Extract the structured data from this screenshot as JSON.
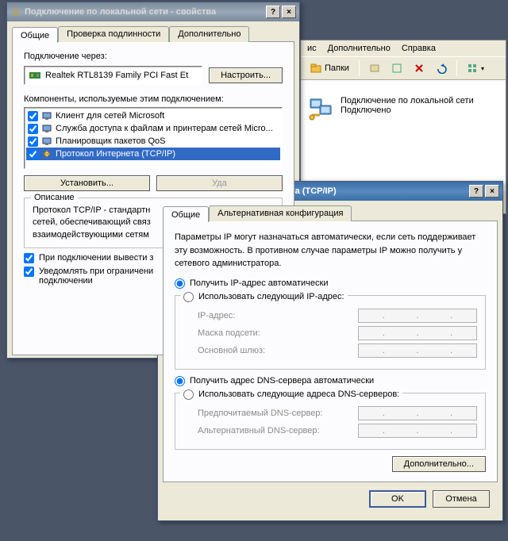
{
  "explorer": {
    "menu": {
      "extra": "ис",
      "extra2": "Дополнительно",
      "help": "Справка"
    },
    "toolbar": {
      "folders": "Папки"
    },
    "connection": {
      "name": "Подключение по локальной сети",
      "status": "Подключено"
    }
  },
  "propWin": {
    "title": "Подключение по локальной сети - свойства",
    "tabs": {
      "general": "Общие",
      "auth": "Проверка подлинности",
      "advanced": "Дополнительно"
    },
    "connect_via_label": "Подключение через:",
    "adapter": "Realtek RTL8139 Family PCI Fast Et",
    "configure_btn": "Настроить...",
    "components_label": "Компоненты, используемые этим подключением:",
    "components": [
      {
        "label": "Клиент для сетей Microsoft",
        "checked": true
      },
      {
        "label": "Служба доступа к файлам и принтерам сетей Micro...",
        "checked": true
      },
      {
        "label": "Планировщик пакетов QoS",
        "checked": true
      },
      {
        "label": "Протокол Интернета (TCP/IP)",
        "checked": true,
        "selected": true
      }
    ],
    "install_btn": "Установить...",
    "uninstall_btn": "Уда",
    "desc_heading": "Описание",
    "desc_text": "Протокол TCP/IP - стандартн\nсетей, обеспечивающий связ\nвзаимодействующими сетям",
    "show_icon": "При подключении вывести з",
    "notify_limited": "Уведомлять при ограничени\nподключении"
  },
  "tcpWin": {
    "title": "Свойства: Протокол Интернета (TCP/IP)",
    "tabs": {
      "general": "Общие",
      "alt": "Альтернативная конфигурация"
    },
    "info": "Параметры IP могут назначаться автоматически, если сеть поддерживает эту возможность. В противном случае параметры IP можно получить у сетевого администратора.",
    "ip_auto": "Получить IP-адрес автоматически",
    "ip_manual": "Использовать следующий IP-адрес:",
    "ip_addr_label": "IP-адрес:",
    "mask_label": "Маска подсети:",
    "gateway_label": "Основной шлюз:",
    "dns_auto": "Получить адрес DNS-сервера автоматически",
    "dns_manual": "Использовать следующие адреса DNS-серверов:",
    "dns_pref_label": "Предпочитаемый DNS-сервер:",
    "dns_alt_label": "Альтернативный DNS-сервер:",
    "advanced_btn": "Дополнительно...",
    "ok": "OK",
    "cancel": "Отмена"
  },
  "icons": {
    "help": "?",
    "close": "×"
  }
}
